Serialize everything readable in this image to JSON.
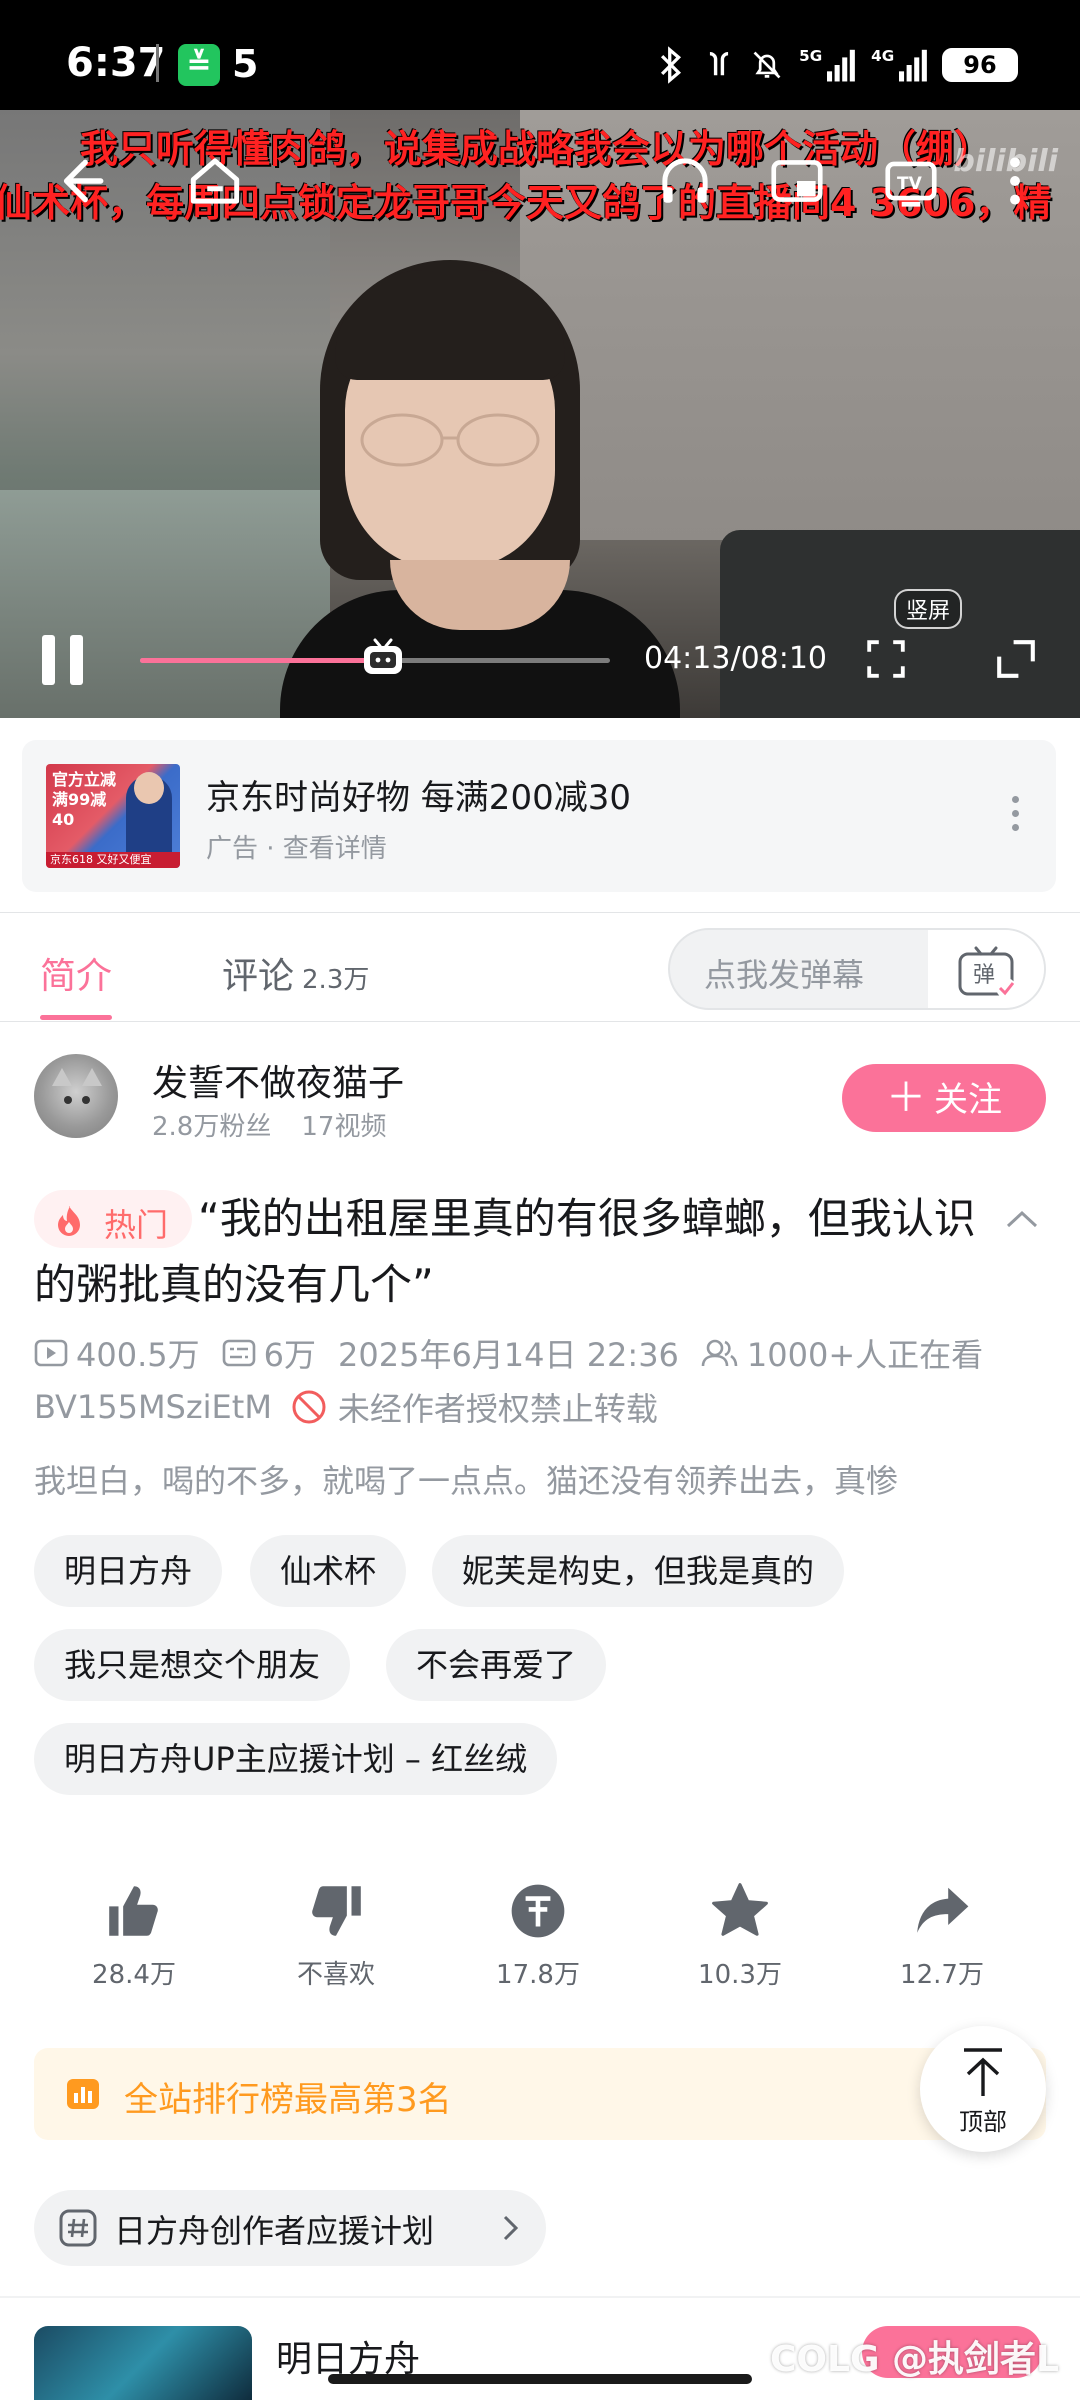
{
  "status_bar": {
    "time": "6:37",
    "notification_count": "5",
    "app_icon": "wechat-pay-icon",
    "battery": "96",
    "network": "5G 4G"
  },
  "video": {
    "danmaku": [
      "我只听得懂肉鸽，说集成战略我会以为哪个活动（绷）",
      "仙术杯，每周四点锁定龙哥哥今天又鸽了的直播间4   3606，精"
    ],
    "watermark": "bilibili",
    "current_time": "04:13",
    "duration": "08:10",
    "time_display": "04:13/08:10",
    "progress": 0.516,
    "vertical_fullscreen_label": "竖屏",
    "colors": {
      "progress": "#fb7299"
    }
  },
  "ad": {
    "title": "京东时尚好物 每满200减30",
    "subtitle": "广告 · 查看详情",
    "thumb_text": "官方立减 满99减40",
    "thumb_footer": "京东618 又好又便宜"
  },
  "tabs": {
    "intro": "简介",
    "comments": "评论",
    "comments_count": "2.3万",
    "danmaku_placeholder": "点我发弹幕",
    "danmaku_button": "弹"
  },
  "uploader": {
    "name": "发誓不做夜猫子",
    "fans": "2.8万粉丝",
    "videos": "17视频",
    "follow_label": "关注"
  },
  "video_info": {
    "hot_badge": "热门",
    "title": "“我的出租屋里真的有很多蟑螂，但我认识的粥批真的没有几个”",
    "views": "400.5万",
    "danmaku_count": "6万",
    "date": "2025年6月14日 22:36",
    "watching": "1000+人正在看",
    "bvid": "BV155MSziEtM",
    "copyright": "未经作者授权禁止转载",
    "description": "我坦白，喝的不多，就喝了一点点。猫还没有领养出去，真惨"
  },
  "tags": [
    "明日方舟",
    "仙术杯",
    "妮芙是构史，但我是真的",
    "我只是想交个朋友",
    "不会再爱了",
    "明日方舟UP主应援计划 – 红丝绒"
  ],
  "actions": {
    "like": "28.4万",
    "dislike": "不喜欢",
    "coin": "17.8万",
    "favorite": "10.3万",
    "share": "12.7万"
  },
  "rank": {
    "text": "全站排行榜最高第3名"
  },
  "back_to_top": "顶部",
  "topic": {
    "text": "日方舟创作者应援计划"
  },
  "related": {
    "title": "明日方舟"
  },
  "watermark": "COLG @执剑者L"
}
